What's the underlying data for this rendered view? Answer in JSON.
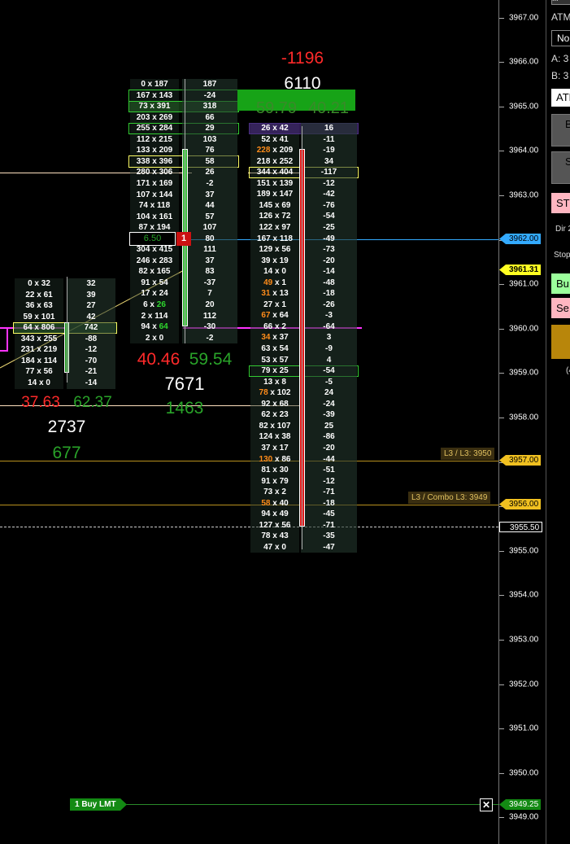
{
  "axis": {
    "ticks": [
      "3967.00",
      "3966.00",
      "3965.00",
      "3964.00",
      "3963.00",
      "3962.00",
      "3961.00",
      "3960.00",
      "3959.00",
      "3958.00",
      "3957.00",
      "3956.00",
      "3955.00",
      "3954.00",
      "3953.00",
      "3952.00",
      "3951.00",
      "3950.00",
      "3949.00"
    ],
    "labels": {
      "blue": "3962.00",
      "yellow": "3961.31",
      "l3a": "3957.00",
      "l3b": "3956.00",
      "dashed": "3955.50",
      "order": "3949.25"
    }
  },
  "annotations": {
    "l3_label": "L3 / L3: 3950",
    "combo_label": "L3 / Combo L3: 3949"
  },
  "order": {
    "label": "1 Buy LMT",
    "close_icon": "✕"
  },
  "colors": {
    "red": "#ff2a2a",
    "green": "#29a329",
    "magenta": "#ff33ff",
    "gold": "#d4aa33",
    "blue": "#33aaff"
  },
  "bar1": {
    "rows": [
      {
        "b": "0",
        "a": "32",
        "d": "32"
      },
      {
        "b": "22",
        "a": "61",
        "d": "39"
      },
      {
        "b": "36",
        "a": "63",
        "d": "27"
      },
      {
        "b": "59",
        "a": "101",
        "d": "42"
      },
      {
        "b": "64",
        "a": "806",
        "d": "742"
      },
      {
        "b": "343",
        "a": "255",
        "d": "-88"
      },
      {
        "b": "231",
        "a": "219",
        "d": "-12"
      },
      {
        "b": "184",
        "a": "114",
        "d": "-70"
      },
      {
        "b": "77",
        "a": "56",
        "d": "-21"
      },
      {
        "b": "14",
        "a": "0",
        "d": "-14"
      }
    ],
    "pct_red": "37.63",
    "pct_green": "62.37",
    "volume": "2737",
    "delta_total": "677"
  },
  "bar2": {
    "rows": [
      {
        "b": "0",
        "a": "187",
        "d": "187"
      },
      {
        "b": "167",
        "a": "143",
        "d": "-24"
      },
      {
        "b": "73",
        "a": "391",
        "d": "318"
      },
      {
        "b": "203",
        "a": "269",
        "d": "66"
      },
      {
        "b": "255",
        "a": "284",
        "d": "29"
      },
      {
        "b": "112",
        "a": "215",
        "d": "103"
      },
      {
        "b": "133",
        "a": "209",
        "d": "76"
      },
      {
        "b": "338",
        "a": "396",
        "d": "58"
      },
      {
        "b": "280",
        "a": "306",
        "d": "26"
      },
      {
        "b": "171",
        "a": "169",
        "d": "-2"
      },
      {
        "b": "107",
        "a": "144",
        "d": "37"
      },
      {
        "b": "74",
        "a": "118",
        "d": "44"
      },
      {
        "b": "104",
        "a": "161",
        "d": "57"
      },
      {
        "b": "87",
        "a": "194",
        "d": "107"
      },
      {
        "b": "",
        "a": "",
        "d": "80"
      },
      {
        "b": "304",
        "a": "415",
        "d": "111"
      },
      {
        "b": "246",
        "a": "283",
        "d": "37"
      },
      {
        "b": "82",
        "a": "165",
        "d": "83"
      },
      {
        "b": "91",
        "a": "54",
        "d": "-37"
      },
      {
        "b": "17",
        "a": "24",
        "d": "7"
      },
      {
        "b": "6",
        "a": "26",
        "d": "20"
      },
      {
        "b": "2",
        "a": "114",
        "d": "112"
      },
      {
        "b": "94",
        "a": "64",
        "d": "-30"
      },
      {
        "b": "2",
        "a": "0",
        "d": "-2"
      }
    ],
    "position_value": "6.50",
    "position_qty": "1",
    "pct_red": "40.46",
    "pct_green": "59.54",
    "volume": "7671",
    "delta_total": "1463"
  },
  "bar3": {
    "rows": [
      {
        "b": "26",
        "a": "42",
        "d": "16"
      },
      {
        "b": "52",
        "a": "41",
        "d": "-11"
      },
      {
        "b": "228",
        "a": "209",
        "d": "-19"
      },
      {
        "b": "218",
        "a": "252",
        "d": "34"
      },
      {
        "b": "344",
        "a": "404",
        "d": "-117"
      },
      {
        "b": "151",
        "a": "139",
        "d": "-12"
      },
      {
        "b": "189",
        "a": "147",
        "d": "-42"
      },
      {
        "b": "145",
        "a": "69",
        "d": "-76"
      },
      {
        "b": "126",
        "a": "72",
        "d": "-54"
      },
      {
        "b": "122",
        "a": "97",
        "d": "-25"
      },
      {
        "b": "167",
        "a": "118",
        "d": "-49"
      },
      {
        "b": "129",
        "a": "56",
        "d": "-73"
      },
      {
        "b": "39",
        "a": "19",
        "d": "-20"
      },
      {
        "b": "14",
        "a": "0",
        "d": "-14"
      },
      {
        "b": "49",
        "a": "1",
        "d": "-48"
      },
      {
        "b": "31",
        "a": "13",
        "d": "-18"
      },
      {
        "b": "27",
        "a": "1",
        "d": "-26"
      },
      {
        "b": "67",
        "a": "64",
        "d": "-3"
      },
      {
        "b": "66",
        "a": "2",
        "d": "-64"
      },
      {
        "b": "34",
        "a": "37",
        "d": "3"
      },
      {
        "b": "63",
        "a": "54",
        "d": "-9"
      },
      {
        "b": "53",
        "a": "57",
        "d": "4"
      },
      {
        "b": "79",
        "a": "25",
        "d": "-54"
      },
      {
        "b": "13",
        "a": "8",
        "d": "-5"
      },
      {
        "b": "78",
        "a": "102",
        "d": "24"
      },
      {
        "b": "92",
        "a": "68",
        "d": "-24"
      },
      {
        "b": "62",
        "a": "23",
        "d": "-39"
      },
      {
        "b": "82",
        "a": "107",
        "d": "25"
      },
      {
        "b": "124",
        "a": "38",
        "d": "-86"
      },
      {
        "b": "37",
        "a": "17",
        "d": "-20"
      },
      {
        "b": "130",
        "a": "86",
        "d": "-44"
      },
      {
        "b": "81",
        "a": "30",
        "d": "-51"
      },
      {
        "b": "91",
        "a": "79",
        "d": "-12"
      },
      {
        "b": "73",
        "a": "2",
        "d": "-71"
      },
      {
        "b": "58",
        "a": "40",
        "d": "-18"
      },
      {
        "b": "94",
        "a": "49",
        "d": "-45"
      },
      {
        "b": "127",
        "a": "56",
        "d": "-71"
      },
      {
        "b": "78",
        "a": "43",
        "d": "-35"
      },
      {
        "b": "47",
        "a": "0",
        "d": "-47"
      }
    ],
    "delta_total": "-1196",
    "volume": "6110",
    "pct_red": "59.79",
    "pct_green": "40.21"
  },
  "panel": {
    "top_btn": "...",
    "atm_label": "ATM",
    "dropdown": "No",
    "a_label": "A: 3",
    "b_label": "B: 3",
    "atm_btn": "ATM",
    "buy_short": "B",
    "sell_short": "S",
    "stop_btn": "ST",
    "dir_label": "Dir 2",
    "stop_label": "Stop",
    "buy_btn": "Bu",
    "sell_btn": "Se",
    "bottom_note": "(4"
  }
}
